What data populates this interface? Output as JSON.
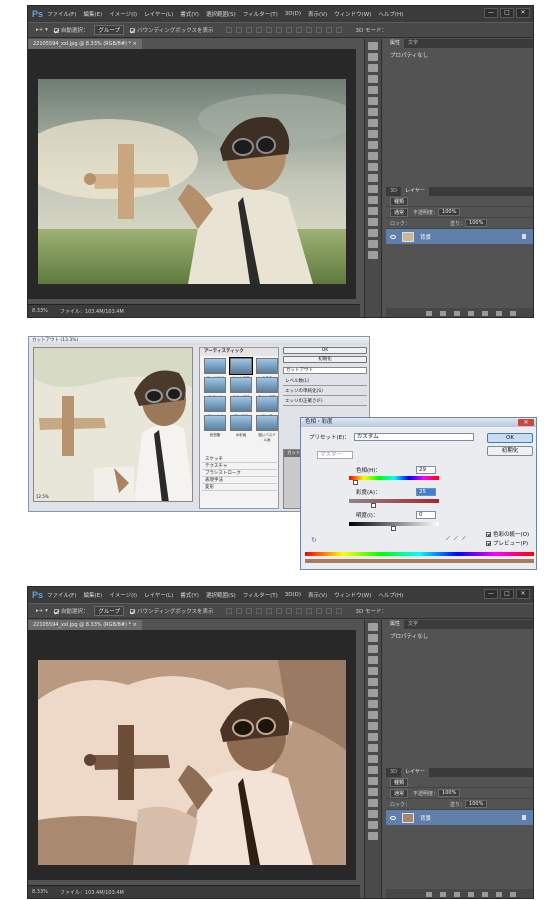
{
  "ps": {
    "logo": "Ps",
    "menu": [
      "ファイル(F)",
      "編集(E)",
      "イメージ(I)",
      "レイヤー(L)",
      "書式(Y)",
      "選択範囲(S)",
      "フィルター(T)",
      "3D(D)",
      "表示(V)",
      "ウィンドウ(W)",
      "ヘルプ(H)"
    ],
    "window_buttons": [
      "—",
      "□",
      "✕"
    ],
    "options": {
      "auto_select": "自動選択：",
      "group": "グループ",
      "bbox": "バウンディングボックスを表示",
      "mode_3d": "3D モード："
    },
    "doc_tab": "22105594_xxl.jpg @ 8.33% (RGB/8#) * ×",
    "panel_tabs": [
      "属性",
      "文字"
    ],
    "properties_text": "プロパティなし",
    "layers_tabs": [
      "3D",
      "レイヤー"
    ],
    "layers": {
      "kind": "種類",
      "blend": "通常",
      "opacity_label": "不透明度：",
      "opacity_value": "100%",
      "lock_label": "ロック：",
      "fill_label": "塗り：",
      "fill_value": "100%",
      "layer_name": "背景"
    },
    "status": {
      "zoom": "8.33%",
      "file": "ファイル：103.4M/103.4M"
    }
  },
  "filter_dialog": {
    "title": "カットアウト (13.3%)",
    "gallery_header": "アーティスティック",
    "thumbs": [
      "エッジのポスタリゼーション",
      "カットアウト",
      "こする",
      "スポンジ",
      "ドライブラシ",
      "ネオン光彩",
      "パレットナイフ",
      "フレスコ",
      "ラップ",
      "色鉛筆",
      "水彩画",
      "粗いパステル画",
      "粗描き",
      "塗料",
      "粒状フィルム"
    ],
    "categories": [
      "スケッチ",
      "テクスチャ",
      "ブラシストローク",
      "表現手法",
      "変形"
    ],
    "ok": "OK",
    "cancel": "初期化",
    "filter_select": "カットアウト",
    "sliders": [
      "レベル数(L)",
      "エッジの単純化(S)",
      "エッジの正確さ(F)"
    ],
    "zoom": "12.5%",
    "effect_item": "カットアウト"
  },
  "hue_dialog": {
    "title": "色相・彩度",
    "preset_label": "プリセット(E)：",
    "preset_value": "カスタム",
    "ok": "OK",
    "reset": "初期化",
    "channel": "マスター",
    "hue_label": "色相(H)：",
    "hue_value": "29",
    "sat_label": "彩度(A)：",
    "sat_value": "25",
    "light_label": "明度(I)：",
    "light_value": "0",
    "colorize": "色彩の統一(O)",
    "preview": "プレビュー(P)"
  }
}
